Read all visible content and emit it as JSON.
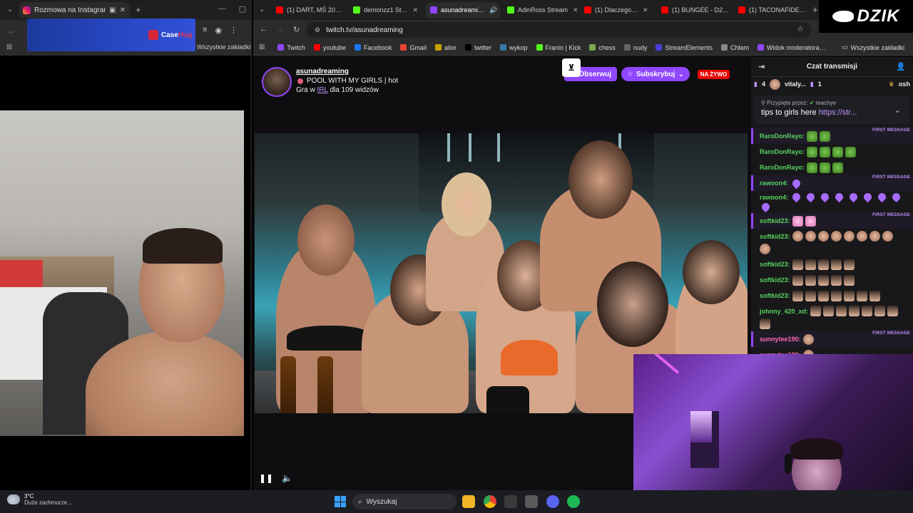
{
  "left_window": {
    "tab_title": "Rozmowa na Instagramie",
    "bookmarks_label": "Wszystkie zakładki",
    "banner_brand_a": "Case",
    "banner_brand_b": "Hug"
  },
  "browser": {
    "tabs": [
      {
        "label": "(1) DART, MŚ 20…",
        "icon": "youtube"
      },
      {
        "label": "demonzz1 St…",
        "icon": "kick"
      },
      {
        "label": "asunadreami…",
        "icon": "twitch",
        "active": true
      },
      {
        "label": "AdinRoss Stream",
        "icon": "kick"
      },
      {
        "label": "(1) Dlaczego…",
        "icon": "youtube"
      },
      {
        "label": "(1) BUNGEE - D2…",
        "icon": "youtube"
      },
      {
        "label": "(1) TACONAFIDE…",
        "icon": "youtube"
      }
    ],
    "url": "twitch.tv/asunadreaming",
    "bookmarks": [
      {
        "label": "Twitch",
        "color": "#9146ff"
      },
      {
        "label": "youtube",
        "color": "#ff0000"
      },
      {
        "label": "Facebook",
        "color": "#1877f2"
      },
      {
        "label": "Gmail",
        "color": "#ea4335"
      },
      {
        "label": "alior",
        "color": "#c8a200"
      },
      {
        "label": "twitter",
        "color": "#000000"
      },
      {
        "label": "wykop",
        "color": "#367aa9"
      },
      {
        "label": "Franio | Kick",
        "color": "#53fc18"
      },
      {
        "label": "chess",
        "color": "#7fa650"
      },
      {
        "label": "nudy",
        "color": "#666666"
      },
      {
        "label": "StreamElements",
        "color": "#4a3ed9"
      },
      {
        "label": "Chłam",
        "color": "#888888"
      },
      {
        "label": "Widok moderatora…",
        "color": "#9146ff"
      }
    ],
    "bookmarks_all": "Wszystkie zakładki"
  },
  "stream": {
    "channel": "asunadreaming",
    "title": "POOL WITH MY GIRLS | hot",
    "meta_prefix": "Gra w",
    "meta_category": "IRL",
    "meta_suffix": "dla 109 widzów",
    "follow_label": "Obserwuj",
    "subscribe_label": "Subskrybuj",
    "live_label": "NA ŻYWO"
  },
  "chat": {
    "header": "Czat transmisji",
    "gift_count": "4",
    "gift_user": "vitaly...",
    "gift_count2": "1",
    "gift_user2": "osh",
    "pinned_by": "Przypięte przez:",
    "pinned_by_user": "reachye",
    "pinned_msg": "tips to girls here",
    "pinned_url": "https://str...",
    "first_message_tag": "FIRST MESSAGE",
    "messages": [
      {
        "user": "RaroDonRayo:",
        "emotes": "green",
        "count": 2,
        "first": true
      },
      {
        "user": "RaroDonRayo:",
        "emotes": "green",
        "count": 4
      },
      {
        "user": "RaroDonRayo:",
        "emotes": "green",
        "count": 3
      },
      {
        "user": "rawoon4:",
        "emotes": "heart",
        "count": 1,
        "first": true
      },
      {
        "user": "rawoon4:",
        "emotes": "heart",
        "count": 9
      },
      {
        "user": "softkid23:",
        "emotes": "pink",
        "count": 2,
        "first": true
      },
      {
        "user": "softkid23:",
        "emotes": "face",
        "count": 9
      },
      {
        "user": "softkid23:",
        "emotes": "girl",
        "count": 5
      },
      {
        "user": "softkid23:",
        "emotes": "girl",
        "count": 5
      },
      {
        "user": "softkid23:",
        "emotes": "girl",
        "count": 7
      },
      {
        "user": "johnny_420_xd:",
        "emotes": "girl",
        "count": 8
      },
      {
        "user": "sunnytee190:",
        "emotes": "face",
        "count": 1,
        "first": true
      },
      {
        "user": "sunnytee190:",
        "emotes": "face",
        "count": 1
      }
    ]
  },
  "overlay": {
    "brand": "DZIK"
  },
  "taskbar": {
    "temp": "3°C",
    "weather": "Duże zachmurze...",
    "search_placeholder": "Wyszukaj"
  }
}
